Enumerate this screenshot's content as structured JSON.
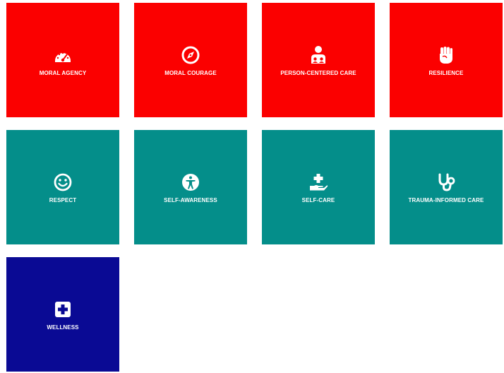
{
  "colors": {
    "red": "#fb0000",
    "teal": "#048e8a",
    "navy": "#0a0a94",
    "icon": "#ffffff"
  },
  "tiles": [
    {
      "label": "MORAL AGENCY",
      "icon": "speedometer-icon",
      "color": "red"
    },
    {
      "label": "MORAL COURAGE",
      "icon": "compass-icon",
      "color": "red"
    },
    {
      "label": "PERSON-CENTERED CARE",
      "icon": "user-group-icon",
      "color": "red"
    },
    {
      "label": "RESILIENCE",
      "icon": "raised-fist-icon",
      "color": "red"
    },
    {
      "label": "RESPECT",
      "icon": "smiley-face-icon",
      "color": "teal"
    },
    {
      "label": "SELF-AWARENESS",
      "icon": "accessibility-person-icon",
      "color": "teal"
    },
    {
      "label": "SELF-CARE",
      "icon": "hand-holding-medical-icon",
      "color": "teal"
    },
    {
      "label": "TRAUMA-INFORMED CARE",
      "icon": "stethoscope-icon",
      "color": "teal"
    },
    {
      "label": "WELLNESS",
      "icon": "medical-plus-square-icon",
      "color": "navy"
    }
  ]
}
